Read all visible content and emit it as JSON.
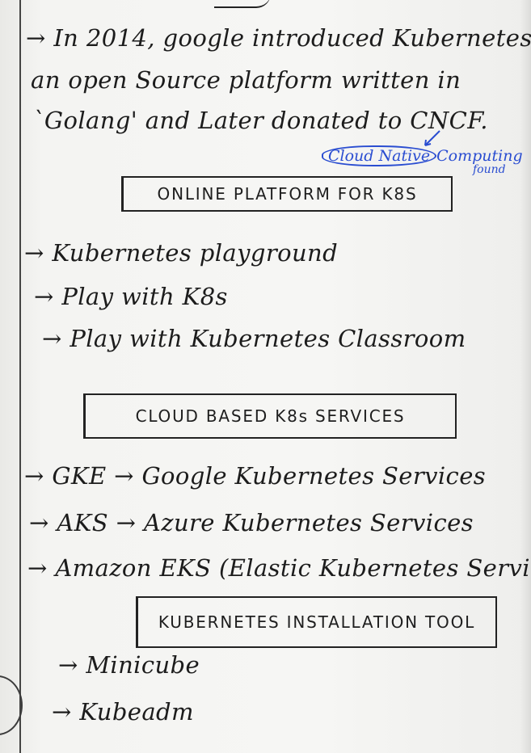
{
  "intro": {
    "line1": "→ In 2014, google introduced Kubernetes",
    "line2": "an open Source platform written in",
    "line3": "`Golang' and Later donated to CNCF."
  },
  "annotation": {
    "circled": "Cloud Native",
    "rest": "Computing",
    "sub": "found"
  },
  "sections": {
    "online": {
      "heading": "ONLINE PLATFORM FOR K8S",
      "items": [
        "→ Kubernetes playground",
        "→ Play with K8s",
        "→ Play with Kubernetes Classroom"
      ]
    },
    "cloud": {
      "heading": "CLOUD BASED K8s SERVICES",
      "items": [
        "→ GKE → Google Kubernetes Services",
        "→ AKS → Azure Kubernetes Services",
        "→ Amazon EKS (Elastic Kubernetes Services)"
      ]
    },
    "tools": {
      "heading": "KUBERNETES INSTALLATION TOOL",
      "items": [
        "→ Minicube",
        "→ Kubeadm"
      ]
    }
  },
  "colors": {
    "ink": "#1c1c1c",
    "blue_ink": "#2a4dd1",
    "paper": "#f4f4f2"
  }
}
